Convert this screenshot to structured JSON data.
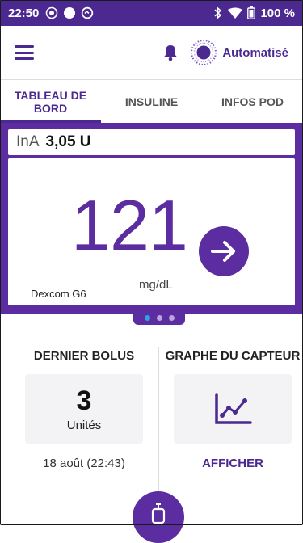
{
  "status_bar": {
    "time": "22:50",
    "battery": "100 %",
    "icons": [
      "record-icon",
      "circle-icon",
      "data-saver-icon",
      "bluetooth-icon",
      "wifi-icon",
      "battery-icon"
    ]
  },
  "app_bar": {
    "menu_icon": "hamburger-menu-icon",
    "bell_icon": "bell-icon",
    "mode_icon": "automated-mode-icon",
    "mode_label": "Automatisé"
  },
  "tabs": [
    {
      "label": "TABLEAU DE BORD",
      "active": true
    },
    {
      "label": "INSULINE",
      "active": false
    },
    {
      "label": "INFOS POD",
      "active": false
    }
  ],
  "dashboard": {
    "ina_label": "InA",
    "ina_value": "3,05 U",
    "glucose_value": "121",
    "glucose_unit": "mg/dL",
    "trend_icon": "arrow-right-icon",
    "sensor_name": "Dexcom G6",
    "page_indicator": {
      "pages": 3,
      "current": 1
    }
  },
  "last_bolus": {
    "title": "DERNIER BOLUS",
    "value": "3",
    "unit": "Unités",
    "datetime": "18 août (22:43)"
  },
  "sensor_graph": {
    "title": "GRAPHE DU CAPTEUR",
    "icon": "line-chart-icon",
    "action_label": "AFFICHER"
  },
  "bolus_button": {
    "icon": "pod-icon"
  },
  "colors": {
    "primary": "#5b2da0",
    "status_bar": "#4b2991",
    "accent_blue": "#2ba3e8"
  }
}
